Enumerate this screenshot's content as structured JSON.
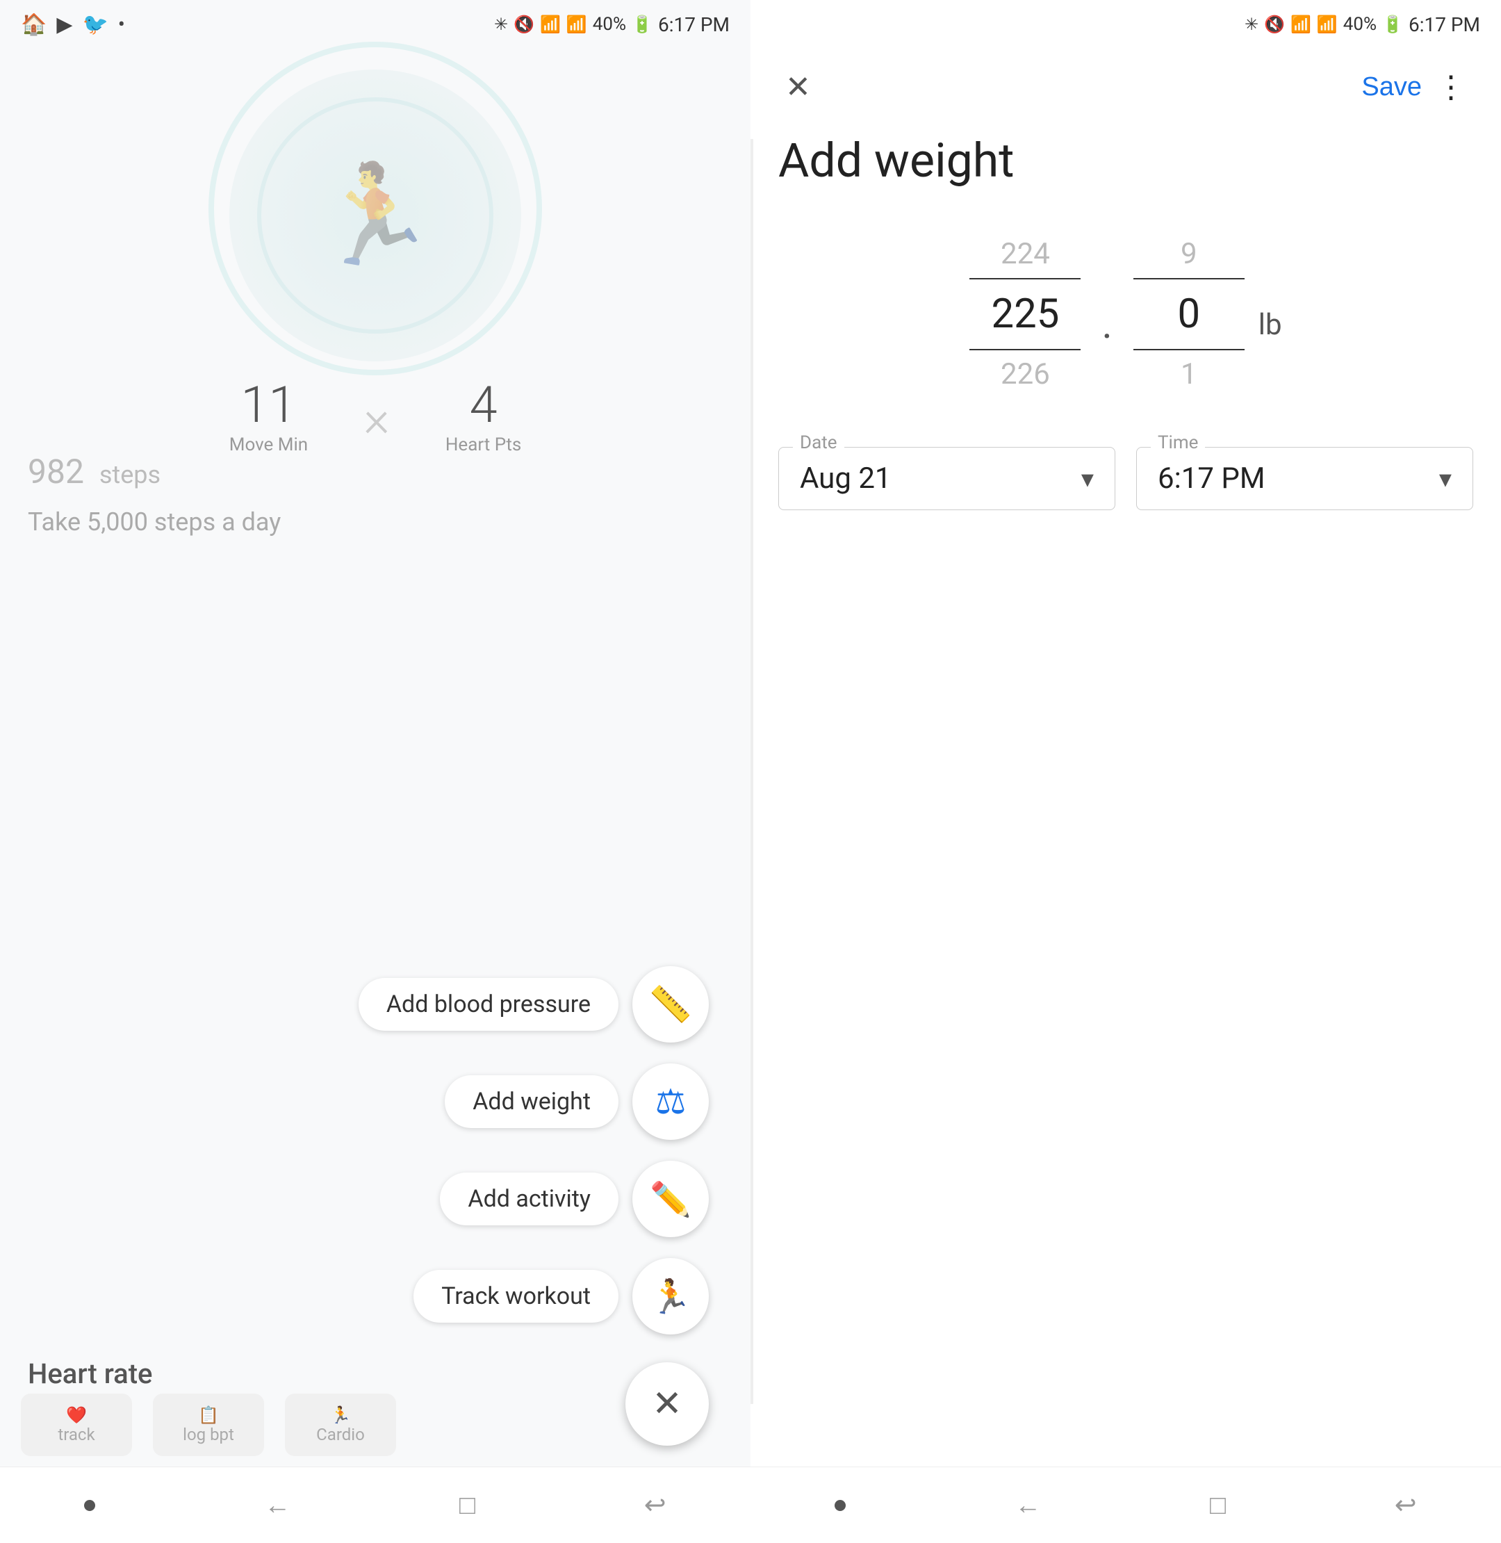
{
  "left": {
    "statusBar": {
      "time": "6:17 PM",
      "battery": "40%",
      "appIcons": [
        "🏠",
        "▶",
        "🐦",
        "•"
      ]
    },
    "stats": {
      "moveMin": "11",
      "moveMinLabel": "Move Min",
      "heartPts": "4",
      "heartPtsLabel": "Heart Pts"
    },
    "steps": {
      "count": "982",
      "label": "steps"
    },
    "goalText": "Take 5,000 steps a day",
    "heartRateLabel": "Heart rate",
    "heartRateCards": [
      {
        "label": "track"
      },
      {
        "label": "log bpt"
      },
      {
        "label": "Cardio"
      }
    ],
    "fabMenu": [
      {
        "label": "Add blood pressure",
        "icon": "📏",
        "iconName": "blood-pressure-icon"
      },
      {
        "label": "Add weight",
        "icon": "⚖",
        "iconName": "weight-icon"
      },
      {
        "label": "Add activity",
        "icon": "✏️",
        "iconName": "activity-icon"
      },
      {
        "label": "Track workout",
        "icon": "🏃",
        "iconName": "workout-icon"
      }
    ],
    "fabCloseIcon": "✕",
    "bottomNav": {
      "items": [
        {
          "icon": "•",
          "label": ""
        },
        {
          "icon": "←",
          "label": ""
        },
        {
          "icon": "□",
          "label": ""
        },
        {
          "icon": "↩",
          "label": ""
        }
      ]
    }
  },
  "right": {
    "statusBar": {
      "time": "6:17 PM",
      "battery": "40%"
    },
    "header": {
      "closeLabel": "✕",
      "saveLabel": "Save",
      "moreLabel": "⋮",
      "title": "Add weight"
    },
    "weightPicker": {
      "whole": {
        "above": "224",
        "selected": "225",
        "below": "226"
      },
      "decimal": {
        "above": "9",
        "selected": "0",
        "below": "1"
      },
      "unit": "lb"
    },
    "dateField": {
      "label": "Date",
      "value": "Aug 21"
    },
    "timeField": {
      "label": "Time",
      "value": "6:17 PM"
    },
    "bottomNav": {
      "items": [
        {
          "icon": "•",
          "label": ""
        },
        {
          "icon": "←",
          "label": ""
        },
        {
          "icon": "□",
          "label": ""
        },
        {
          "icon": "↩",
          "label": ""
        }
      ]
    }
  }
}
